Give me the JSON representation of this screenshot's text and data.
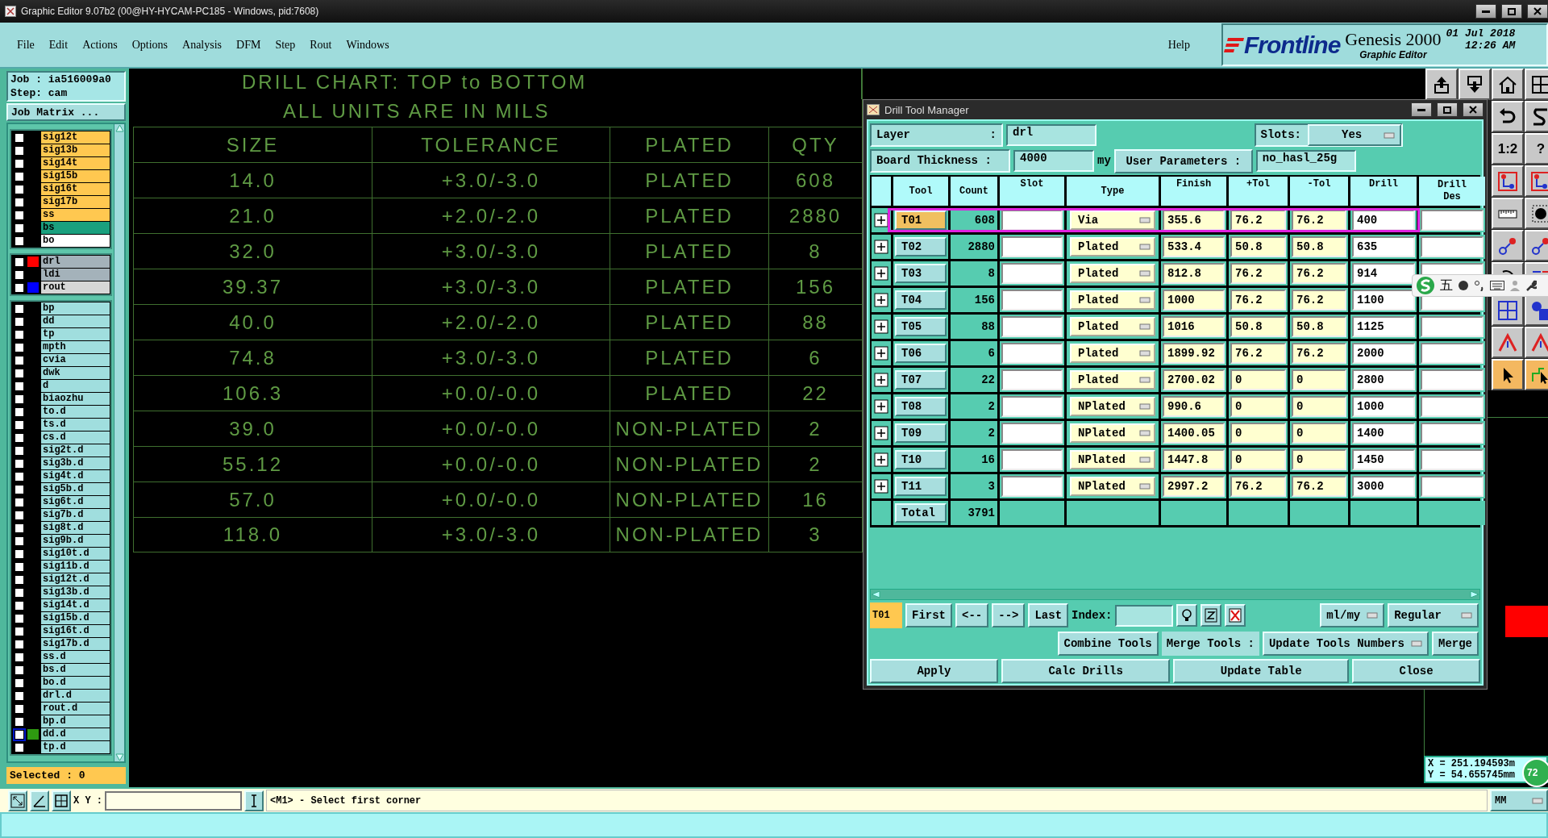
{
  "window": {
    "title": "Graphic Editor 9.07b2 (00@HY-HYCAM-PC185 - Windows, pid:7608)"
  },
  "menu": [
    "File",
    "Edit",
    "Actions",
    "Options",
    "Analysis",
    "DFM",
    "Step",
    "Rout",
    "Windows"
  ],
  "help": "Help",
  "brand": {
    "logo": "Frontline",
    "product": "Genesis 2000",
    "subtitle": "Graphic Editor",
    "date": "01 Jul 2018",
    "time": "12:26 AM"
  },
  "job_panel": {
    "job": "Job : ia516009a0",
    "step": "Step: cam",
    "matrix_button": "Job Matrix ...",
    "selected": "Selected : 0",
    "layer_groups": [
      [
        {
          "name": "sig12t",
          "kind": "signal",
          "checked": false
        },
        {
          "name": "sig13b",
          "kind": "signal",
          "checked": false
        },
        {
          "name": "sig14t",
          "kind": "signal",
          "checked": false
        },
        {
          "name": "sig15b",
          "kind": "signal",
          "checked": false
        },
        {
          "name": "sig16t",
          "kind": "signal",
          "checked": false
        },
        {
          "name": "sig17b",
          "kind": "signal",
          "checked": false
        },
        {
          "name": "ss",
          "kind": "signal",
          "checked": false
        },
        {
          "name": "bs",
          "kind": "mask",
          "checked": false
        },
        {
          "name": "bo",
          "kind": "outline",
          "checked": false
        }
      ],
      [
        {
          "name": "drl",
          "kind": "drill",
          "color": "#ff0000",
          "checked": false
        },
        {
          "name": "ldi",
          "kind": "drill",
          "checked": false
        },
        {
          "name": "rout",
          "kind": "rout",
          "color": "#0000ff",
          "checked": false
        }
      ],
      [
        {
          "name": "bp",
          "kind": "doc",
          "checked": false
        },
        {
          "name": "dd",
          "kind": "doc",
          "checked": false
        },
        {
          "name": "tp",
          "kind": "doc",
          "checked": false
        },
        {
          "name": "mpth",
          "kind": "doc",
          "checked": false
        },
        {
          "name": "cvia",
          "kind": "doc",
          "checked": false
        },
        {
          "name": "dwk",
          "kind": "doc",
          "checked": false
        },
        {
          "name": "d",
          "kind": "doc",
          "checked": false
        },
        {
          "name": "biaozhu",
          "kind": "doc",
          "checked": false
        },
        {
          "name": "to.d",
          "kind": "doc",
          "checked": false
        },
        {
          "name": "ts.d",
          "kind": "doc",
          "checked": false
        },
        {
          "name": "cs.d",
          "kind": "doc",
          "checked": false
        },
        {
          "name": "sig2t.d",
          "kind": "doc",
          "checked": false
        },
        {
          "name": "sig3b.d",
          "kind": "doc",
          "checked": false
        },
        {
          "name": "sig4t.d",
          "kind": "doc",
          "checked": false
        },
        {
          "name": "sig5b.d",
          "kind": "doc",
          "checked": false
        },
        {
          "name": "sig6t.d",
          "kind": "doc",
          "checked": false
        },
        {
          "name": "sig7b.d",
          "kind": "doc",
          "checked": false
        },
        {
          "name": "sig8t.d",
          "kind": "doc",
          "checked": false
        },
        {
          "name": "sig9b.d",
          "kind": "doc",
          "checked": false
        },
        {
          "name": "sig10t.d",
          "kind": "doc",
          "checked": false
        },
        {
          "name": "sig11b.d",
          "kind": "doc",
          "checked": false
        },
        {
          "name": "sig12t.d",
          "kind": "doc",
          "checked": false
        },
        {
          "name": "sig13b.d",
          "kind": "doc",
          "checked": false
        },
        {
          "name": "sig14t.d",
          "kind": "doc",
          "checked": false
        },
        {
          "name": "sig15b.d",
          "kind": "doc",
          "checked": false
        },
        {
          "name": "sig16t.d",
          "kind": "doc",
          "checked": false
        },
        {
          "name": "sig17b.d",
          "kind": "doc",
          "checked": false
        },
        {
          "name": "ss.d",
          "kind": "doc",
          "checked": false
        },
        {
          "name": "bs.d",
          "kind": "doc",
          "checked": false
        },
        {
          "name": "bo.d",
          "kind": "doc",
          "checked": false
        },
        {
          "name": "drl.d",
          "kind": "doc",
          "checked": false
        },
        {
          "name": "rout.d",
          "kind": "doc",
          "checked": false
        },
        {
          "name": "bp.d",
          "kind": "doc",
          "checked": false
        },
        {
          "name": "dd.d",
          "kind": "doc",
          "color": "#2e9a10",
          "checked": false,
          "active": true
        },
        {
          "name": "tp.d",
          "kind": "doc",
          "checked": false
        }
      ]
    ]
  },
  "drill_chart": {
    "title": "DRILL CHART: TOP to BOTTOM",
    "units": "ALL UNITS ARE IN MILS",
    "columns": [
      "SIZE",
      "TOLERANCE",
      "PLATED",
      "QTY"
    ],
    "rows": [
      [
        "14.0",
        "+3.0/-3.0",
        "PLATED",
        "608"
      ],
      [
        "21.0",
        "+2.0/-2.0",
        "PLATED",
        "2880"
      ],
      [
        "32.0",
        "+3.0/-3.0",
        "PLATED",
        "8"
      ],
      [
        "39.37",
        "+3.0/-3.0",
        "PLATED",
        "156"
      ],
      [
        "40.0",
        "+2.0/-2.0",
        "PLATED",
        "88"
      ],
      [
        "74.8",
        "+3.0/-3.0",
        "PLATED",
        "6"
      ],
      [
        "106.3",
        "+0.0/-0.0",
        "PLATED",
        "22"
      ],
      [
        "39.0",
        "+0.0/-0.0",
        "NON-PLATED",
        "2"
      ],
      [
        "55.12",
        "+0.0/-0.0",
        "NON-PLATED",
        "2"
      ],
      [
        "57.0",
        "+0.0/-0.0",
        "NON-PLATED",
        "16"
      ],
      [
        "118.0",
        "+3.0/-3.0",
        "NON-PLATED",
        "3"
      ]
    ]
  },
  "dialog": {
    "title": "Drill Tool Manager",
    "layer_label": "Layer",
    "layer_colon": ":",
    "layer_value": "drl",
    "slots_label": "Slots:",
    "slots_value": "Yes",
    "thickness_label": "Board Thickness :",
    "thickness_value": "4000",
    "thickness_unit": "my",
    "user_params_button": "User Parameters :",
    "user_params_value": "no_hasl_25g",
    "columns": [
      [
        "Tool"
      ],
      [
        "Count"
      ],
      [
        "Slot"
      ],
      [
        "Type"
      ],
      [
        "Finish"
      ],
      [
        "+Tol"
      ],
      [
        "-Tol"
      ],
      [
        "Drill"
      ],
      [
        "Drill",
        "Des"
      ]
    ],
    "rows": [
      {
        "tool": "T01",
        "count": "608",
        "type": "Via",
        "finish": "355.6",
        "plus_tol": "76.2",
        "minus_tol": "76.2",
        "drill_size": "400",
        "selected": true
      },
      {
        "tool": "T02",
        "count": "2880",
        "type": "Plated",
        "finish": "533.4",
        "plus_tol": "50.8",
        "minus_tol": "50.8",
        "drill_size": "635",
        "selected": false
      },
      {
        "tool": "T03",
        "count": "8",
        "type": "Plated",
        "finish": "812.8",
        "plus_tol": "76.2",
        "minus_tol": "76.2",
        "drill_size": "914",
        "selected": false
      },
      {
        "tool": "T04",
        "count": "156",
        "type": "Plated",
        "finish": "1000",
        "plus_tol": "76.2",
        "minus_tol": "76.2",
        "drill_size": "1100",
        "selected": false
      },
      {
        "tool": "T05",
        "count": "88",
        "type": "Plated",
        "finish": "1016",
        "plus_tol": "50.8",
        "minus_tol": "50.8",
        "drill_size": "1125",
        "selected": false
      },
      {
        "tool": "T06",
        "count": "6",
        "type": "Plated",
        "finish": "1899.92",
        "plus_tol": "76.2",
        "minus_tol": "76.2",
        "drill_size": "2000",
        "selected": false
      },
      {
        "tool": "T07",
        "count": "22",
        "type": "Plated",
        "finish": "2700.02",
        "plus_tol": "0",
        "minus_tol": "0",
        "drill_size": "2800",
        "selected": false
      },
      {
        "tool": "T08",
        "count": "2",
        "type": "NPlated",
        "finish": "990.6",
        "plus_tol": "0",
        "minus_tol": "0",
        "drill_size": "1000",
        "selected": false
      },
      {
        "tool": "T09",
        "count": "2",
        "type": "NPlated",
        "finish": "1400.05",
        "plus_tol": "0",
        "minus_tol": "0",
        "drill_size": "1400",
        "selected": false
      },
      {
        "tool": "T10",
        "count": "16",
        "type": "NPlated",
        "finish": "1447.8",
        "plus_tol": "0",
        "minus_tol": "0",
        "drill_size": "1450",
        "selected": false
      },
      {
        "tool": "T11",
        "count": "3",
        "type": "NPlated",
        "finish": "2997.2",
        "plus_tol": "76.2",
        "minus_tol": "76.2",
        "drill_size": "3000",
        "selected": false
      }
    ],
    "total": {
      "label": "Total",
      "count": "3791"
    },
    "nav": {
      "current": "T01",
      "buttons": [
        "First",
        "<--",
        "-->",
        "Last"
      ],
      "index_label": "Index:",
      "units": "ml/my",
      "mode": "Regular"
    },
    "combine_button": "Combine Tools",
    "merge_label": "Merge Tools :",
    "merge_mode": "Update Tools Numbers",
    "merge_button": "Merge",
    "actions": [
      "Apply",
      "Calc Drills",
      "Update Table",
      "Close"
    ]
  },
  "right_toolbar": [
    [
      {
        "kind": "upload"
      },
      {
        "kind": "download"
      },
      {
        "kind": "home"
      },
      {
        "kind": "grid"
      }
    ],
    [
      {
        "kind": "undo"
      },
      {
        "kind": "curve"
      }
    ],
    [
      {
        "kind": "text",
        "label": "1:2"
      },
      {
        "kind": "text",
        "label": "?"
      }
    ],
    [
      {
        "kind": "net"
      },
      {
        "kind": "net"
      }
    ],
    [
      {
        "kind": "ruler"
      },
      {
        "kind": "pad"
      }
    ],
    [
      {
        "kind": "connect"
      },
      {
        "kind": "connect"
      }
    ],
    [
      {
        "kind": "arc"
      },
      {
        "kind": "layers"
      }
    ],
    [
      {
        "kind": "chip"
      },
      {
        "kind": "shapes"
      }
    ],
    [
      {
        "kind": "profile"
      },
      {
        "kind": "profile"
      }
    ],
    [
      {
        "kind": "pointer"
      },
      {
        "kind": "route"
      }
    ]
  ],
  "ime_toolbar": {
    "mode": "五"
  },
  "coordinates": {
    "x": "X = 251.194593m",
    "y": "Y = 54.655745mm"
  },
  "badge": "72",
  "status_bar": {
    "xy_label": "X Y :",
    "prompt": "<M1> - Select first corner",
    "units": "MM"
  }
}
